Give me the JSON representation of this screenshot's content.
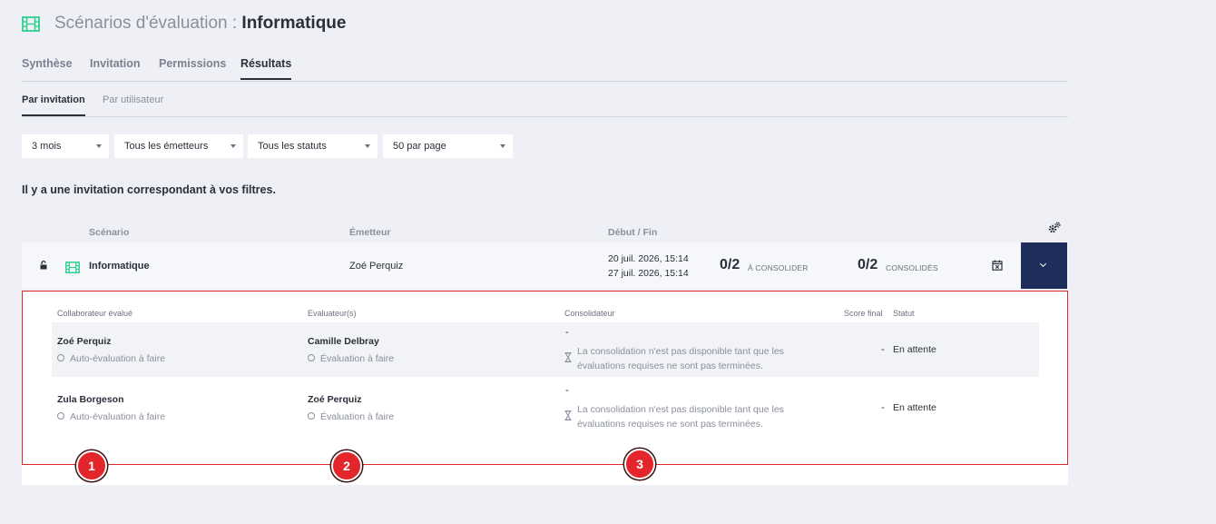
{
  "header": {
    "title_prefix": "Scénarios d'évaluation : ",
    "title_name": "Informatique"
  },
  "tabs": [
    "Synthèse",
    "Invitation",
    "Permissions",
    "Résultats"
  ],
  "subtabs": [
    "Par invitation",
    "Par utilisateur"
  ],
  "filters": [
    "3 mois",
    "Tous les émetteurs",
    "Tous les statuts",
    "50 par page"
  ],
  "result_count": "Il y a une invitation correspondant à vos filtres.",
  "table_headers": {
    "scenario": "Scénario",
    "emetteur": "Émetteur",
    "debut_fin": "Début / Fin"
  },
  "invitation": {
    "scenario": "Informatique",
    "emetteur": "Zoé Perquiz",
    "debut": "20 juil. 2026, 15:14",
    "fin": "27 juil. 2026, 15:14",
    "a_consolider_count": "0/2",
    "a_consolider_label": "À CONSOLIDER",
    "consolides_count": "0/2",
    "consolides_label": "CONSOLIDÉS"
  },
  "detail_headers": {
    "collaborateur": "Collaborateur évalué",
    "evaluateurs": "Evaluateur(s)",
    "consolidateur": "Consolidateur",
    "score": "Score final",
    "statut": "Statut"
  },
  "detail_rows": [
    {
      "collaborateur": "Zoé Perquiz",
      "collab_status": "Auto-évaluation à faire",
      "evaluateur": "Camille Delbray",
      "eval_status": "Évaluation à faire",
      "consolidateur": "-",
      "consolidation_msg": "La consolidation n'est pas disponible tant que les évaluations requises ne sont pas terminées.",
      "score": "-",
      "statut": "En attente"
    },
    {
      "collaborateur": "Zula Borgeson",
      "collab_status": "Auto-évaluation à faire",
      "evaluateur": "Zoé Perquiz",
      "eval_status": "Évaluation à faire",
      "consolidateur": "-",
      "consolidation_msg": "La consolidation n'est pas disponible tant que les évaluations requises ne sont pas terminées.",
      "score": "-",
      "statut": "En attente"
    }
  ],
  "markers": [
    "1",
    "2",
    "3"
  ],
  "colors": {
    "accent_green": "#2fcf8f",
    "navy": "#1e2d5a",
    "highlight_red": "#e2262b",
    "background": "#eef0f6"
  }
}
